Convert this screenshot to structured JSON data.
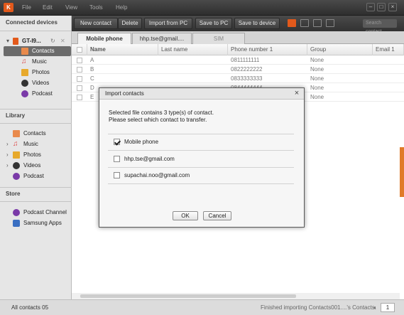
{
  "app": {
    "logo": "K",
    "menu": [
      "File",
      "Edit",
      "View",
      "Tools",
      "Help"
    ]
  },
  "sidebar": {
    "connected_header": "Connected devices",
    "device_name": "GT-I9...",
    "device_items": [
      "Contacts",
      "Music",
      "Photos",
      "Videos",
      "Podcast"
    ],
    "library_header": "Library",
    "library_items": [
      "Contacts",
      "Music",
      "Photos",
      "Videos",
      "Podcast"
    ],
    "store_header": "Store",
    "store_items": [
      "Podcast Channel",
      "Samsung Apps"
    ]
  },
  "toolbar": {
    "buttons": [
      "New contact",
      "Delete",
      "Import from PC",
      "Save to PC",
      "Save to device"
    ],
    "search_placeholder": "Search contact"
  },
  "tabs": [
    "Mobile phone",
    "hhp.tse@gmail....",
    "SIM"
  ],
  "grid": {
    "columns": [
      "Name",
      "Last name",
      "Phone number 1",
      "Group",
      "Email 1"
    ],
    "rows": [
      {
        "name": "A",
        "last": "",
        "phone": "0811111111",
        "group": "None"
      },
      {
        "name": "B",
        "last": "",
        "phone": "0822222222",
        "group": "None"
      },
      {
        "name": "C",
        "last": "",
        "phone": "0833333333",
        "group": "None"
      },
      {
        "name": "D",
        "last": "",
        "phone": "0844444444",
        "group": "None"
      },
      {
        "name": "E",
        "last": "",
        "phone": "",
        "group": "None"
      }
    ]
  },
  "dialog": {
    "title": "Import contacts",
    "message_line1": "Selected file contains 3 type(s) of contact.",
    "message_line2": "Please select which contact to transfer.",
    "options": [
      {
        "label": "Mobile phone",
        "checked": true
      },
      {
        "label": "hhp.tse@gmail.com",
        "checked": false
      },
      {
        "label": "supachai.noo@gmail.com",
        "checked": false
      }
    ],
    "ok_label": "OK",
    "cancel_label": "Cancel"
  },
  "status": {
    "left": "All contacts 05",
    "right": "Finished importing Contacts001....'s Contacts.",
    "page": "1"
  },
  "colors": {
    "accent": "#e2591b",
    "toolbar_bg": "#3a3a3a",
    "selected_item": "#6b6b6b"
  }
}
